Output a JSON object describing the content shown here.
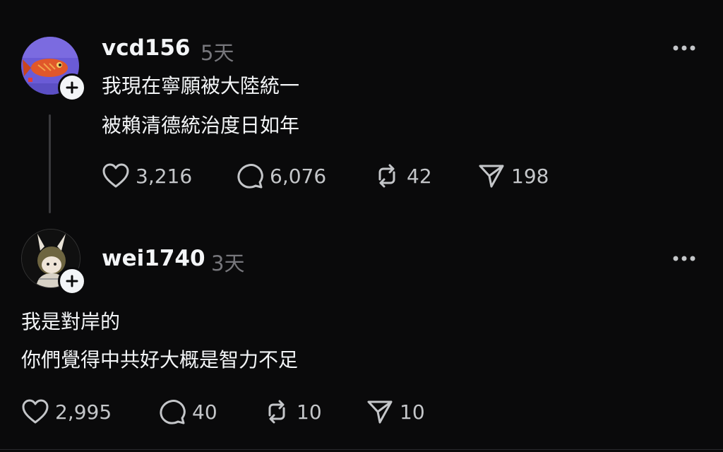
{
  "posts": [
    {
      "username": "vcd156",
      "time": "5天",
      "lines": [
        "我現在寧願被大陸統一",
        "被賴清德統治度日如年"
      ],
      "likes": "3,216",
      "replies": "6,076",
      "reposts": "42",
      "shares": "198"
    },
    {
      "username": "wei1740",
      "time": "3天",
      "lines": [
        "我是對岸的",
        "你們覺得中共好大概是智力不足"
      ],
      "likes": "2,995",
      "replies": "40",
      "reposts": "10",
      "shares": "10"
    }
  ],
  "colors": {
    "background": "#0a0a0b",
    "text": "#f3f5f7",
    "muted": "#77777c"
  }
}
